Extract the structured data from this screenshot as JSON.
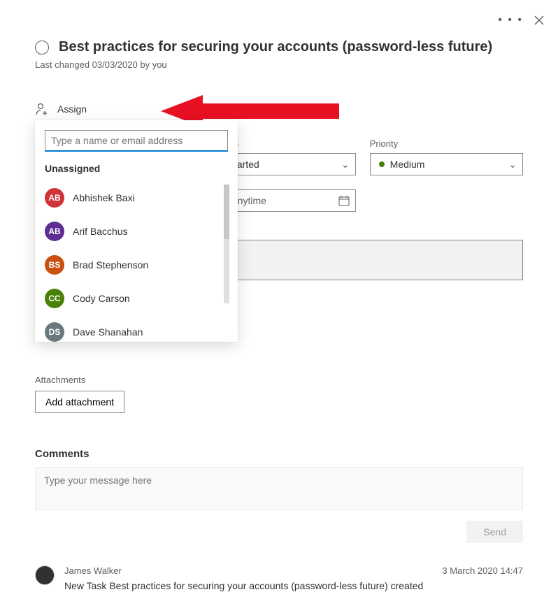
{
  "header": {
    "title": "Best practices for securing your accounts (password-less future)",
    "meta": "Last changed 03/03/2020 by you"
  },
  "assign": {
    "label": "Assign",
    "search_placeholder": "Type a name or email address",
    "unassigned_header": "Unassigned",
    "people": [
      {
        "name": "Abhishek Baxi",
        "color": "#d13438"
      },
      {
        "name": "Arif Bacchus",
        "color": "#5c2e91"
      },
      {
        "name": "Brad Stephenson",
        "color": "#ca5010"
      },
      {
        "name": "Cody Carson",
        "color": "#498205"
      },
      {
        "name": "Dave Shanahan",
        "color": "#69797e"
      }
    ]
  },
  "fields": {
    "progress_label": "Progress",
    "progress_value": "Not started",
    "priority_label": "Priority",
    "priority_value": "Medium",
    "due_placeholder": "Due anytime"
  },
  "attachments": {
    "label": "Attachments",
    "button": "Add attachment"
  },
  "comments": {
    "label": "Comments",
    "placeholder": "Type your message here",
    "send": "Send"
  },
  "activity": {
    "author": "James Walker",
    "timestamp": "3 March 2020 14:47",
    "text": "New Task Best practices for securing your accounts (password-less future) created"
  }
}
